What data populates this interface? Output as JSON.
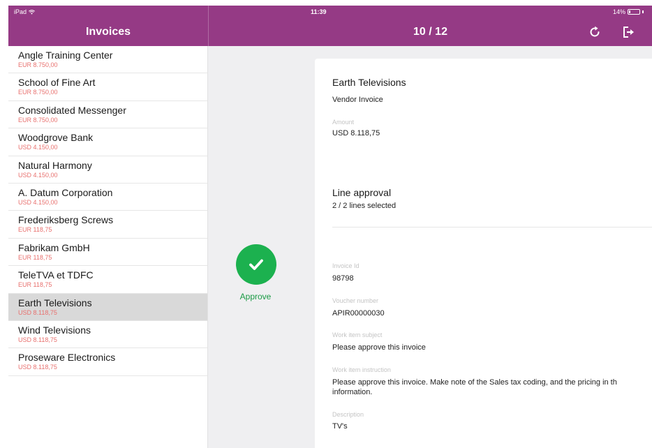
{
  "status": {
    "carrier": "iPad",
    "time": "11:39",
    "battery": "14%"
  },
  "left_header": {
    "title": "Invoices"
  },
  "right_header": {
    "title": "10 / 12"
  },
  "invoices": [
    {
      "name": "Angle Training Center",
      "amount": "EUR 8.750,00"
    },
    {
      "name": "School of Fine Art",
      "amount": "EUR 8.750,00"
    },
    {
      "name": "Consolidated Messenger",
      "amount": "EUR 8.750,00"
    },
    {
      "name": "Woodgrove Bank",
      "amount": "USD 4.150,00"
    },
    {
      "name": "Natural Harmony",
      "amount": "USD 4.150,00"
    },
    {
      "name": "A. Datum Corporation",
      "amount": "USD 4.150,00"
    },
    {
      "name": "Frederiksberg Screws",
      "amount": "EUR 118,75"
    },
    {
      "name": "Fabrikam GmbH",
      "amount": "EUR 118,75"
    },
    {
      "name": "TeleTVA et TDFC",
      "amount": "EUR 118,75"
    },
    {
      "name": "Earth Televisions",
      "amount": "USD 8.118,75"
    },
    {
      "name": "Wind Televisions",
      "amount": "USD 8.118,75"
    },
    {
      "name": "Proseware Electronics",
      "amount": "USD 8.118,75"
    }
  ],
  "selected_index": 9,
  "approve": {
    "label": "Approve"
  },
  "detail": {
    "vendor": "Earth Televisions",
    "type": "Vendor Invoice",
    "amount_label": "Amount",
    "amount_value": "USD 8.118,75",
    "line_approval_title": "Line approval",
    "line_approval_value": "2 / 2 lines selected",
    "invoice_id_label": "Invoice Id",
    "invoice_id_value": "98798",
    "voucher_label": "Voucher number",
    "voucher_value": "APIR00000030",
    "subject_label": "Work item subject",
    "subject_value": "Please approve this invoice",
    "instruction_label": "Work item instruction",
    "instruction_line1": "Please approve this invoice. Make note of the Sales tax coding, and the pricing in th",
    "instruction_line2": "information.",
    "description_label": "Description",
    "description_value": "TV's"
  },
  "colors": {
    "header": "#953a85",
    "amount": "#e8706e",
    "approve": "#1cb14f"
  }
}
